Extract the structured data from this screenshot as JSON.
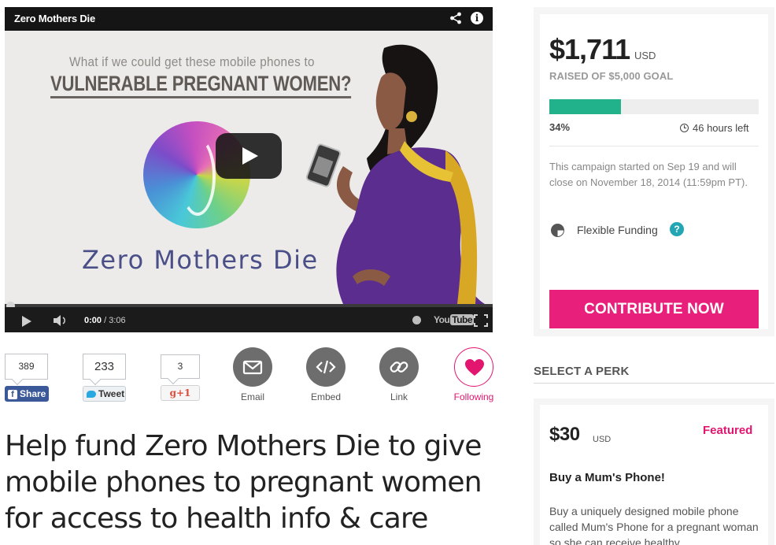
{
  "video": {
    "title": "Zero Mothers Die",
    "poster_question": "What if we could get these mobile phones to",
    "poster_headline": "VULNERABLE PREGNANT WOMEN?",
    "poster_brand": "Zero Mothers Die",
    "current_time": "0:00",
    "duration": "/ 3:06",
    "youtube_label": "You",
    "youtube_tube": "Tube"
  },
  "social": {
    "facebook": {
      "count": "389",
      "label": "Share"
    },
    "twitter": {
      "count": "233",
      "label": "Tweet"
    },
    "googleplus": {
      "count": "3",
      "label": "g+1"
    },
    "actions": [
      {
        "label": "Email",
        "icon": "envelope-icon"
      },
      {
        "label": "Embed",
        "icon": "code-icon"
      },
      {
        "label": "Link",
        "icon": "link-icon"
      },
      {
        "label": "Following",
        "icon": "heart-icon"
      }
    ]
  },
  "heading": "Help fund Zero Mothers Die to give mobile phones to pregnant women for access to health info & care",
  "campaign": {
    "raised": "$1,711",
    "currency": "USD",
    "goal_text": "RAISED OF $5,000 GOAL",
    "percent_label": "34%",
    "progress_fraction": 0.3422,
    "time_left": "46 hours left",
    "note": "This campaign started on Sep 19 and will close on November 18, 2014 (11:59pm PT).",
    "funding_type": "Flexible Funding",
    "help_glyph": "?",
    "cta": "CONTRIBUTE NOW",
    "accent_color": "#e8207c",
    "progress_color": "#21b28c"
  },
  "perks": {
    "header": "SELECT A PERK",
    "items": [
      {
        "price": "$30",
        "currency": "USD",
        "badge": "Featured",
        "title": "Buy a Mum's Phone!",
        "description": "Buy a uniquely designed mobile phone called Mum's Phone for a pregnant woman so she can receive healthy"
      }
    ]
  }
}
